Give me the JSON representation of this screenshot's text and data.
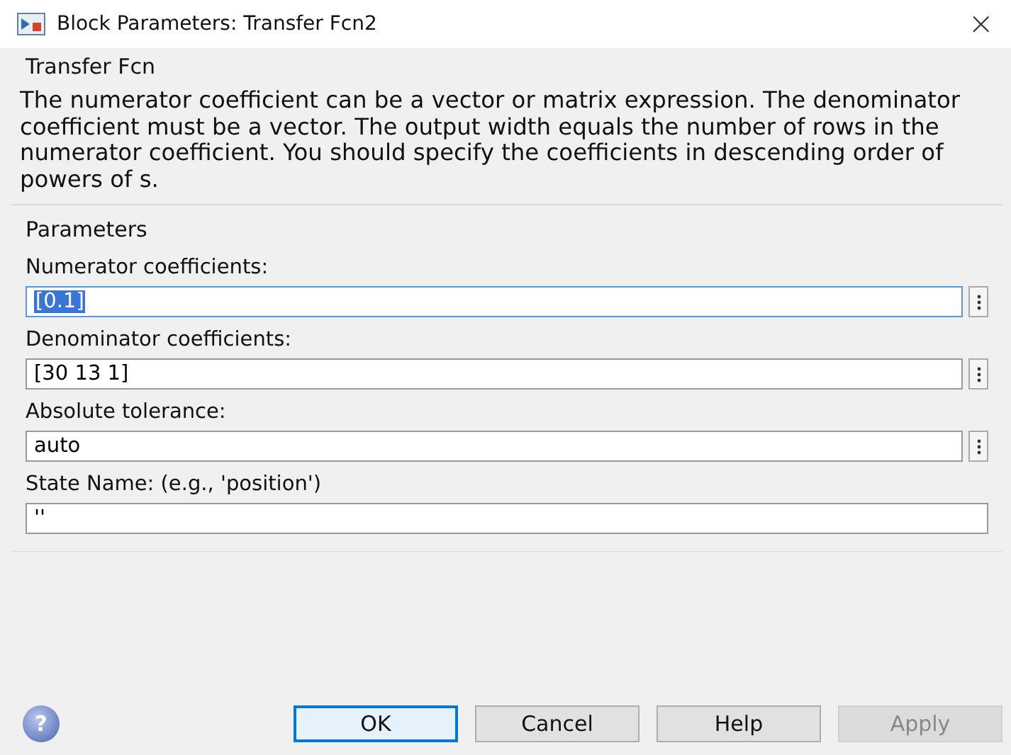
{
  "window": {
    "title": "Block Parameters: Transfer Fcn2",
    "close": "×"
  },
  "description": {
    "title": "Transfer Fcn",
    "text": "The numerator coefficient can be a vector or matrix expression. The denominator coefficient must be a vector. The output width equals the number of rows in the numerator coefficient. You should specify the coefficients in descending order of powers of s."
  },
  "parameters": {
    "title": "Parameters",
    "fields": [
      {
        "label": "Numerator coefficients:",
        "value": "[0.1]",
        "selected": true,
        "menu": true
      },
      {
        "label": "Denominator coefficients:",
        "value": "[30 13 1]",
        "selected": false,
        "menu": true
      },
      {
        "label": "Absolute tolerance:",
        "value": "auto",
        "selected": false,
        "menu": true
      },
      {
        "label": "State Name: (e.g., 'position')",
        "value": "''",
        "selected": false,
        "menu": false
      }
    ]
  },
  "help_icon": "?",
  "buttons": [
    {
      "label": "OK",
      "default": true,
      "disabled": false
    },
    {
      "label": "Cancel",
      "default": false,
      "disabled": false
    },
    {
      "label": "Help",
      "default": false,
      "disabled": false
    },
    {
      "label": "Apply",
      "default": false,
      "disabled": true
    }
  ]
}
